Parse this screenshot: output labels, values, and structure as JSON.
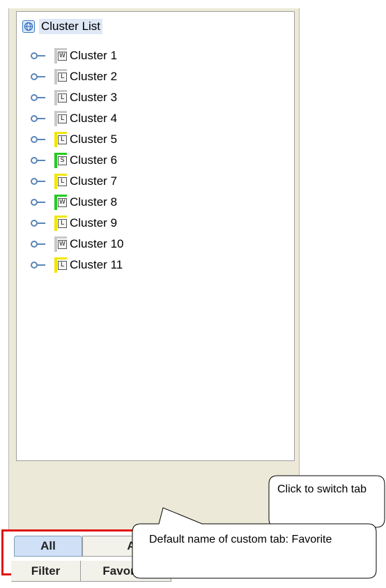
{
  "tree": {
    "root_label": "Cluster List",
    "items": [
      {
        "label": "Cluster 1",
        "badge": "W",
        "stripe": "#c8c8c8",
        "bar": "#c8c8c8"
      },
      {
        "label": "Cluster 2",
        "badge": "L",
        "stripe": "#c8c8c8",
        "bar": "#c8c8c8"
      },
      {
        "label": "Cluster 3",
        "badge": "L",
        "stripe": "#c8c8c8",
        "bar": "#c8c8c8"
      },
      {
        "label": "Cluster 4",
        "badge": "L",
        "stripe": "#c8c8c8",
        "bar": "#c8c8c8"
      },
      {
        "label": "Cluster 5",
        "badge": "L",
        "stripe": "#f0e600",
        "bar": "#f0e600"
      },
      {
        "label": "Cluster 6",
        "badge": "S",
        "stripe": "#22cc22",
        "bar": "#22cc22"
      },
      {
        "label": "Cluster 7",
        "badge": "L",
        "stripe": "#f0e600",
        "bar": "#f0e600"
      },
      {
        "label": "Cluster 8",
        "badge": "W",
        "stripe": "#22cc22",
        "bar": "#22cc22"
      },
      {
        "label": "Cluster 9",
        "badge": "L",
        "stripe": "#f0e600",
        "bar": "#f0e600"
      },
      {
        "label": "Cluster 10",
        "badge": "W",
        "stripe": "#c8c8c8",
        "bar": "#c8c8c8"
      },
      {
        "label": "Cluster 11",
        "badge": "L",
        "stripe": "#f0e600",
        "bar": "#f0e600"
      }
    ]
  },
  "tabs": {
    "all": "All",
    "abnormal": "Abnormal",
    "filter": "Filter",
    "favorite": "Favorite",
    "selected": "All"
  },
  "callouts": {
    "switch_tab": "Click to switch tab",
    "custom_tab": "Default name of custom tab: Favorite"
  },
  "colors": {
    "highlight": "#e01010",
    "selected_tab": "#cfe0f7"
  }
}
